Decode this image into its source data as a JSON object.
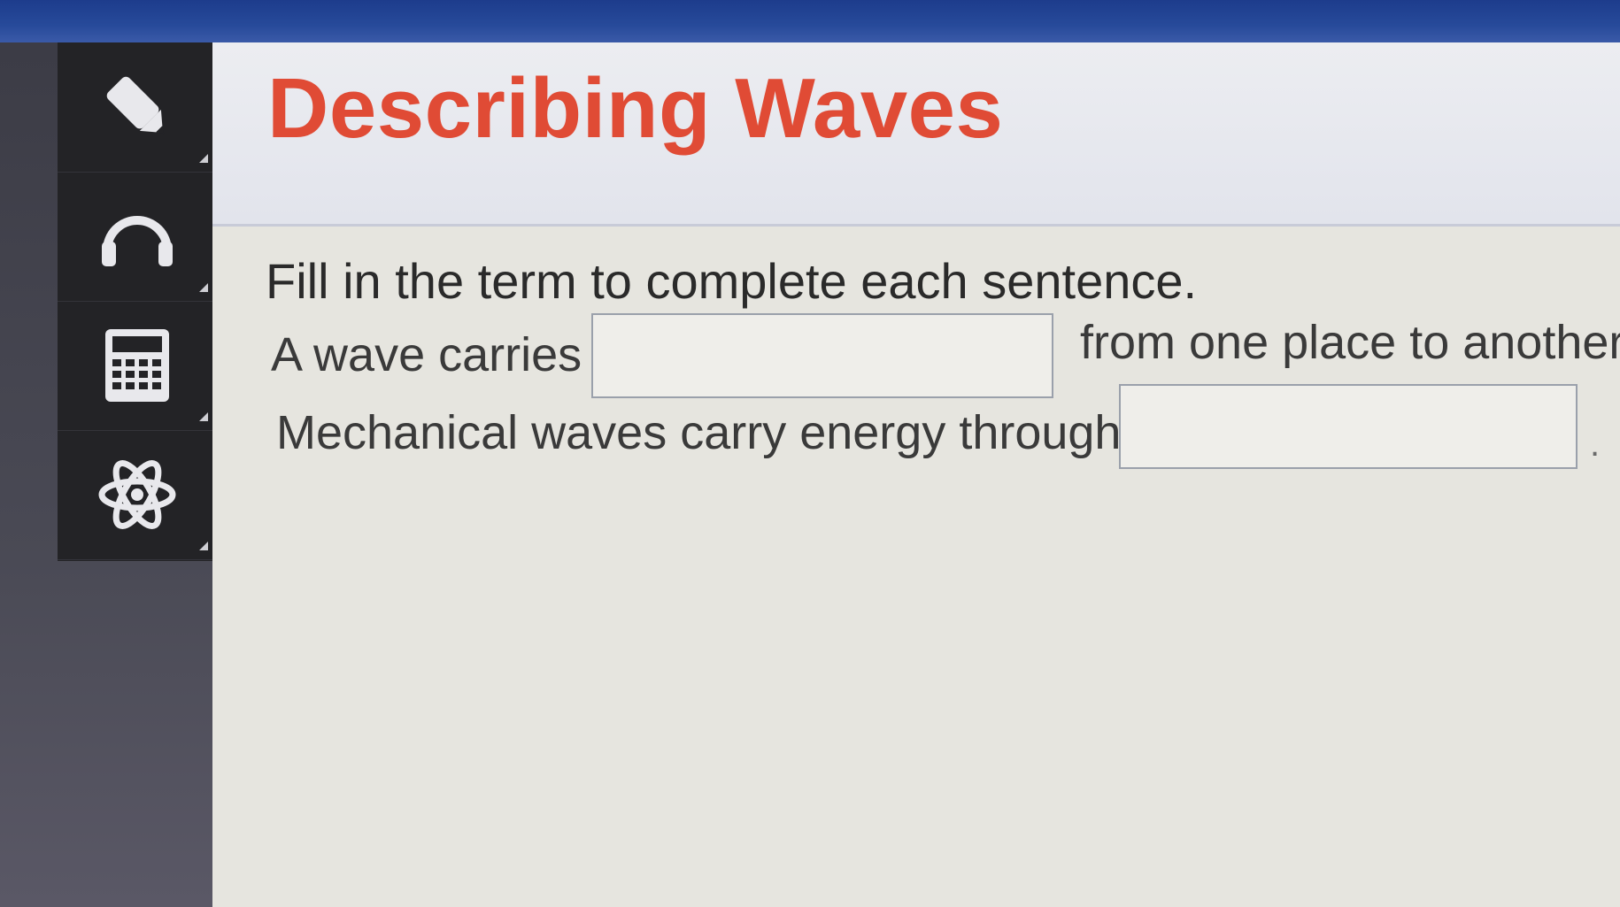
{
  "page": {
    "title": "Describing Waves",
    "instruction": "Fill in the term to complete each sentence."
  },
  "toolbar": {
    "tools": [
      {
        "icon": "pencil-icon",
        "label": ""
      },
      {
        "icon": "headphones-icon",
        "label": ""
      },
      {
        "icon": "calculator-icon",
        "label": ""
      },
      {
        "icon": "atom-icon",
        "label": ""
      }
    ]
  },
  "questions": {
    "q1": {
      "prefix": "A wave carries",
      "answer_value": "",
      "suffix": "from one place to another"
    },
    "q2": {
      "prefix": "Mechanical waves carry energy through",
      "answer_value": "",
      "suffix": "."
    }
  },
  "colors": {
    "title": "#e04b35",
    "top_bar": "#274a9a",
    "toolbar": "#232326"
  }
}
